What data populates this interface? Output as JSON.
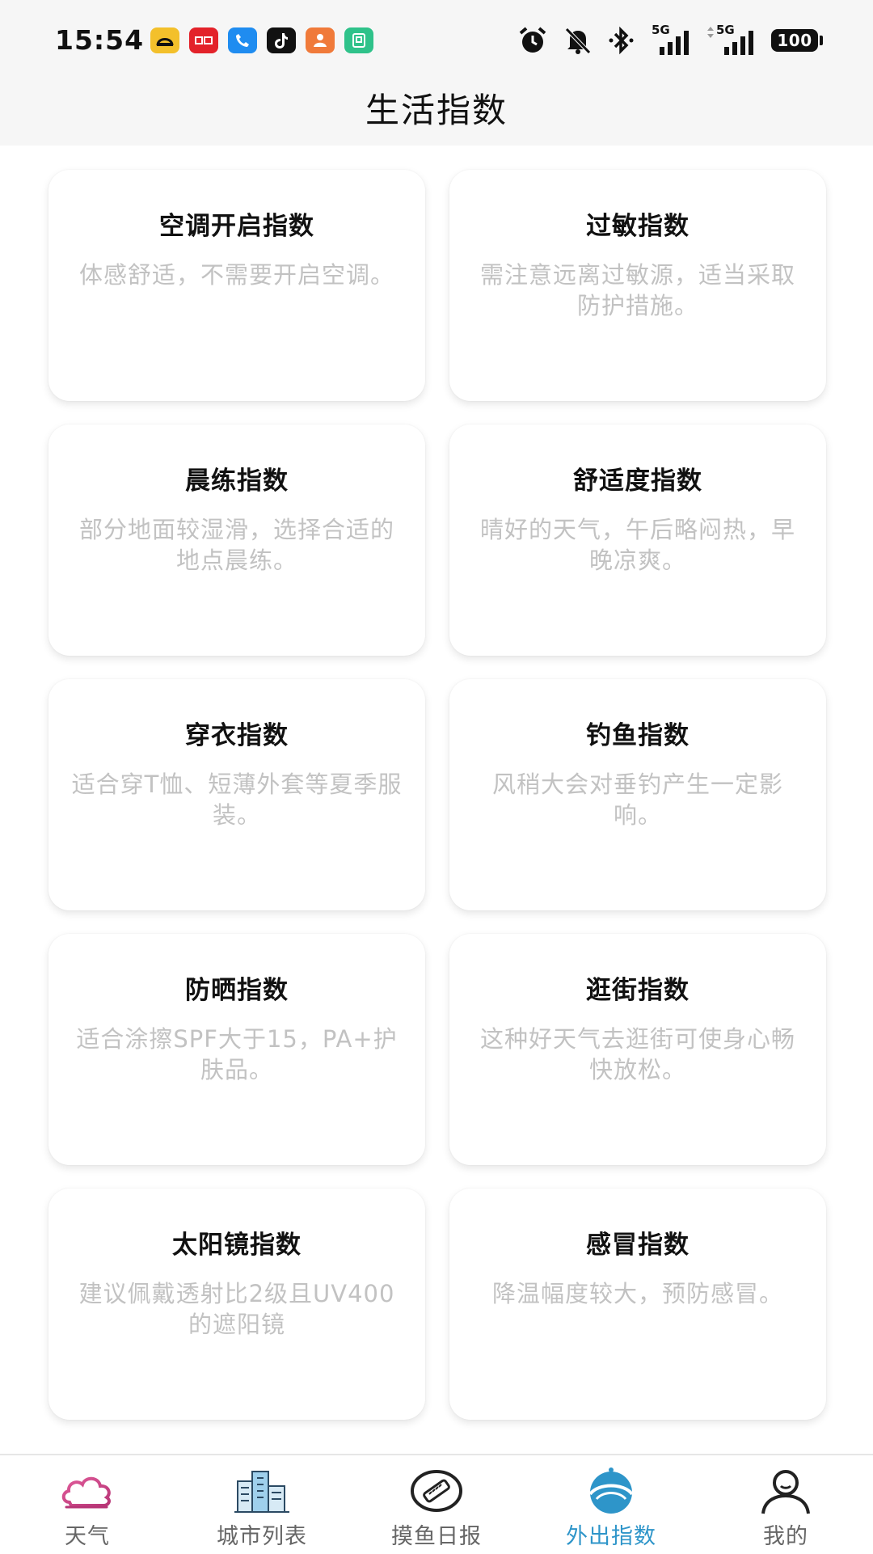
{
  "status_bar": {
    "time": "15:54",
    "battery": "100",
    "network_1": "5G",
    "network_2": "5G",
    "app_icons": [
      {
        "name": "amap-icon",
        "color": "#f3c02b"
      },
      {
        "name": "qidian-icon",
        "color": "#e3222a"
      },
      {
        "name": "phone-icon",
        "color": "#1f8cf0"
      },
      {
        "name": "tiktok-icon",
        "color": "#111111"
      },
      {
        "name": "taobao-special-icon",
        "color": "#f07a3a"
      },
      {
        "name": "notes-icon",
        "color": "#2fc28a"
      }
    ]
  },
  "header": {
    "title": "生活指数"
  },
  "cards": [
    {
      "title": "空调开启指数",
      "desc": "体感舒适，不需要开启空调。"
    },
    {
      "title": "过敏指数",
      "desc": "需注意远离过敏源，适当采取防护措施。"
    },
    {
      "title": "晨练指数",
      "desc": "部分地面较湿滑，选择合适的地点晨练。"
    },
    {
      "title": "舒适度指数",
      "desc": "晴好的天气，午后略闷热，早晚凉爽。"
    },
    {
      "title": "穿衣指数",
      "desc": "适合穿T恤、短薄外套等夏季服装。"
    },
    {
      "title": "钓鱼指数",
      "desc": "风稍大会对垂钓产生一定影响。"
    },
    {
      "title": "防晒指数",
      "desc": "适合涂擦SPF大于15，PA+护肤品。"
    },
    {
      "title": "逛街指数",
      "desc": "这种好天气去逛街可使身心畅快放松。"
    },
    {
      "title": "太阳镜指数",
      "desc": "建议佩戴透射比2级且UV400的遮阳镜"
    },
    {
      "title": "感冒指数",
      "desc": "降温幅度较大，预防感冒。"
    }
  ],
  "bottom_nav": {
    "active_color": "#2e95c9",
    "items": [
      {
        "label": "天气",
        "icon": "cloud-icon"
      },
      {
        "label": "城市列表",
        "icon": "city-buildings-icon"
      },
      {
        "label": "摸鱼日报",
        "icon": "fish-report-icon"
      },
      {
        "label": "外出指数",
        "icon": "outing-index-icon",
        "active": true
      },
      {
        "label": "我的",
        "icon": "user-icon"
      }
    ]
  }
}
